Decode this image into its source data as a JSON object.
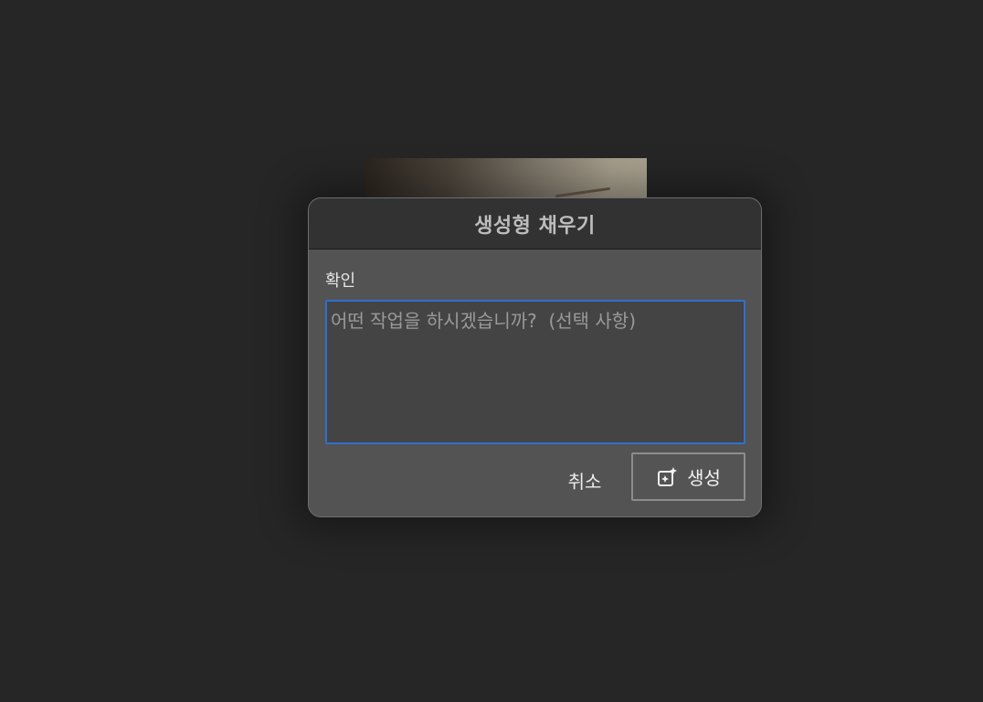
{
  "dialog": {
    "title": "생성형 채우기",
    "field_label": "확인",
    "prompt": {
      "value": "",
      "placeholder": "어떤 작업을 하시겠습니까?  (선택 사항)"
    },
    "cancel_label": "취소",
    "generate_label": "생성",
    "generate_icon": "sparkle-generate-icon"
  },
  "colors": {
    "background": "#262626",
    "dialog_body": "#535353",
    "dialog_header": "#323232",
    "focus_border": "#2f6fd0"
  }
}
